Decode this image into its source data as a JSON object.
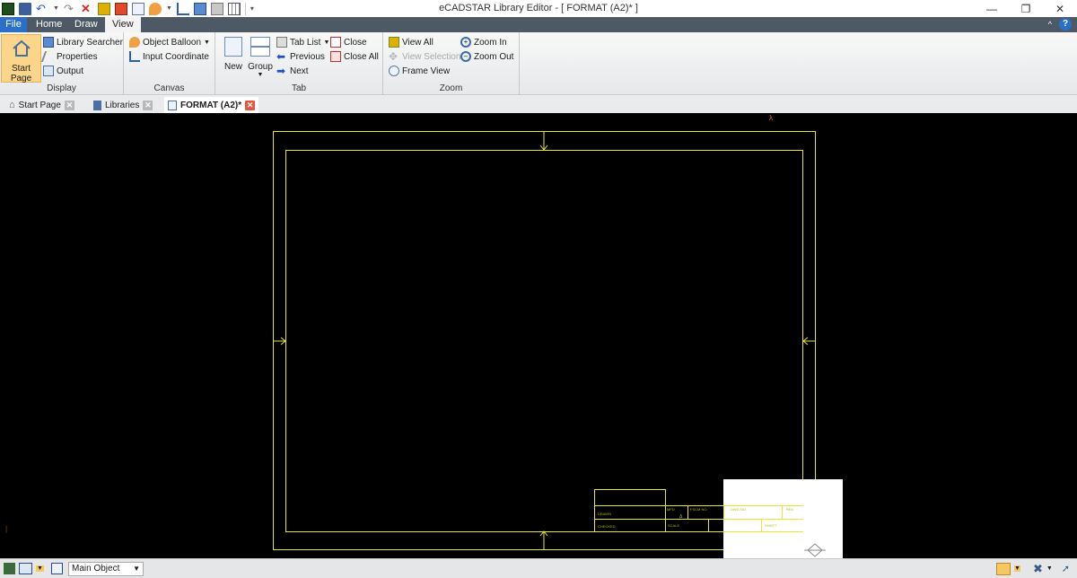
{
  "window": {
    "title": "eCADSTAR Library Editor - [ FORMAT (A2)* ]"
  },
  "menu": {
    "tabs": [
      "File",
      "Home",
      "Draw",
      "View"
    ],
    "active": "View"
  },
  "ribbon": {
    "display": {
      "label": "Display",
      "start_page": "Start Page",
      "library_searcher": "Library Searcher",
      "properties": "Properties",
      "output": "Output"
    },
    "canvas": {
      "label": "Canvas",
      "object_balloon": "Object Balloon",
      "input_coordinate": "Input Coordinate"
    },
    "tab": {
      "label": "Tab",
      "new": "New",
      "group": "Group",
      "tab_list": "Tab List",
      "previous": "Previous",
      "next": "Next",
      "close": "Close",
      "close_all": "Close All"
    },
    "zoom": {
      "label": "Zoom",
      "view_all": "View All",
      "view_selection": "View Selection",
      "frame_view": "Frame View",
      "zoom_in": "Zoom In",
      "zoom_out": "Zoom Out"
    }
  },
  "doc_tabs": [
    {
      "label": "Start Page",
      "icon": "home-icon",
      "active": false
    },
    {
      "label": "Libraries",
      "icon": "book-icon",
      "active": false
    },
    {
      "label": "FORMAT (A2)*",
      "icon": "document-icon",
      "active": true
    }
  ],
  "drawing": {
    "title_block": {
      "drawn": "DRAWN",
      "checked": "CHECKED",
      "mfd": "MFD",
      "fscm": "FSCM NO.",
      "dwg": "DWG NO.",
      "rev": "REV.",
      "scale": "SCALE",
      "sheet": "SHEET"
    },
    "colors": {
      "frame": "#e8e830",
      "background": "#000000"
    }
  },
  "status": {
    "object_select": "Main Object"
  }
}
